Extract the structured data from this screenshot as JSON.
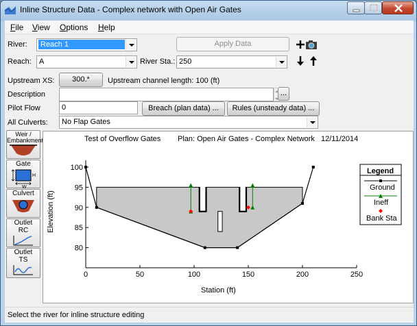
{
  "window": {
    "title": "Inline Structure Data - Complex network with Open Air Gates"
  },
  "menu": [
    {
      "underline": "F",
      "rest": "ile"
    },
    {
      "underline": "V",
      "rest": "iew"
    },
    {
      "underline": "O",
      "rest": "ptions"
    },
    {
      "underline": "H",
      "rest": "elp"
    }
  ],
  "form": {
    "river_label": "River:",
    "river_value": "Reach 1",
    "apply_label": "Apply Data",
    "reach_label": "Reach:",
    "reach_value": "A",
    "river_sta_label": "River Sta.:",
    "river_sta_value": "250",
    "upstream_xs_label": "Upstream XS:",
    "upstream_xs_value": "300.*",
    "upstream_length": "Upstream channel length: 100 (ft)",
    "description_label": "Description",
    "description_value": "",
    "description_button": "...",
    "pilot_flow_label": "Pilot Flow",
    "pilot_flow_value": "0",
    "breach_button": "Breach (plan data) ...",
    "rules_button": "Rules (unsteady data) ...",
    "all_culverts_label": "All Culverts:",
    "all_culverts_value": "No Flap Gates"
  },
  "side_buttons": [
    {
      "label": "Weir /\nEmbankment",
      "icon": "weir-icon"
    },
    {
      "label": "Gate",
      "icon": "gate-icon"
    },
    {
      "label": "Culvert",
      "icon": "culvert-icon"
    },
    {
      "label": "Outlet\nRC",
      "icon": "outlet-rc-icon"
    },
    {
      "label": "Outlet\nTS",
      "icon": "outlet-ts-icon"
    }
  ],
  "chart_data": {
    "type": "line",
    "title": "Test of Overflow Gates",
    "plan": "Plan: Open Air Gates - Complex Network",
    "date": "12/11/2014",
    "xlabel": "Station (ft)",
    "ylabel": "Elevation (ft)",
    "xlim": [
      0,
      250
    ],
    "ylim": [
      75,
      100
    ],
    "xticks": [
      "0",
      "50",
      "100",
      "150",
      "200",
      "250"
    ],
    "yticks": [
      "100",
      "95",
      "90",
      "85",
      "80"
    ],
    "ground": [
      [
        0,
        100
      ],
      [
        10,
        90
      ],
      [
        110,
        80
      ],
      [
        140,
        80
      ],
      [
        200,
        91
      ],
      [
        210,
        100
      ]
    ],
    "weir_top": [
      [
        10,
        95
      ],
      [
        200,
        95
      ]
    ],
    "gates": [
      [
        108,
        95,
        89
      ],
      [
        145,
        95,
        89
      ]
    ],
    "gate_interior_opening": [
      124,
      89,
      84
    ],
    "ineff": [
      [
        97,
        95.5,
        89
      ],
      [
        154,
        95.5,
        90
      ]
    ],
    "bank_sta": [
      [
        97,
        89
      ],
      [
        150,
        90
      ]
    ],
    "legend": {
      "title": "Legend",
      "entries": [
        "Ground",
        "Ineff",
        "Bank Sta"
      ]
    },
    "colors": {
      "ground": "#000000",
      "ineff": "#008000",
      "bank_sta": "#ff0000",
      "fill": "#c8c8c8"
    }
  },
  "status": {
    "text": "Select the river for inline structure editing"
  }
}
